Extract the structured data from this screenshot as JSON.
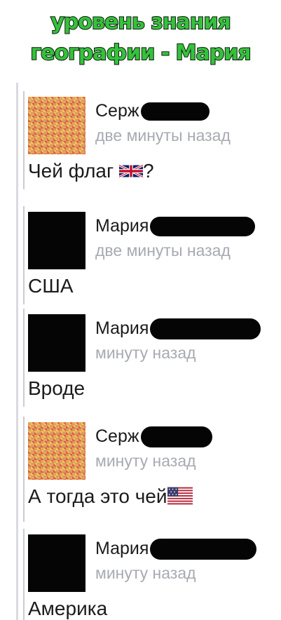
{
  "header": {
    "line1": "уровень знания",
    "line2": "географии - Мария"
  },
  "messages": [
    {
      "author": "Серж",
      "avatar": "pixelated-avatar",
      "time": "две минуты назад",
      "text": "Чей флаг",
      "suffix": "?",
      "flag": "uk-flag-emoji"
    },
    {
      "author": "Мария",
      "avatar": "black-avatar",
      "time": "две минуты назад",
      "text": "США"
    },
    {
      "author": "Мария",
      "avatar": "black-avatar",
      "time": "минуту назад",
      "text": "Вроде"
    },
    {
      "author": "Серж",
      "avatar": "pixelated-avatar",
      "time": "минуту назад",
      "text": "А тогда это чей",
      "flag": "us-flag-emoji"
    },
    {
      "author": "Мария",
      "avatar": "black-avatar",
      "time": "минуту назад",
      "text": "Америка"
    }
  ]
}
